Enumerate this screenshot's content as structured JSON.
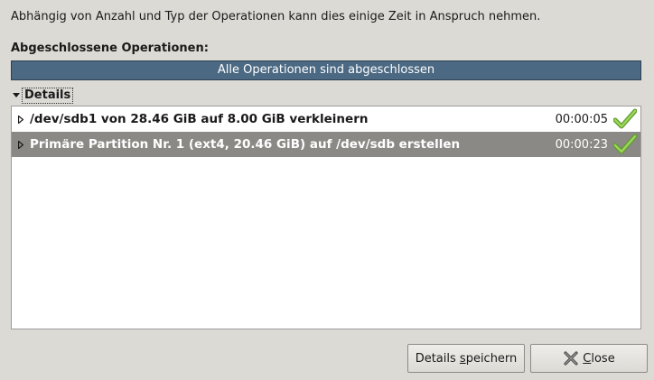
{
  "info_text": "Abhängig von Anzahl und Typ der Operationen kann dies einige Zeit in Anspruch nehmen.",
  "completed_label": "Abgeschlossene Operationen:",
  "progress": {
    "text": "Alle Operationen sind abgeschlossen",
    "fraction": 1.0
  },
  "details": {
    "label": "Details",
    "expanded": true
  },
  "operations": [
    {
      "text": "/dev/sdb1 von 28.46 GiB auf 8.00 GiB verkleinern",
      "time": "00:00:05",
      "status": "check-icon",
      "selected": false
    },
    {
      "text": "Primäre Partition Nr. 1 (ext4, 20.46 GiB) auf /dev/sdb erstellen",
      "time": "00:00:23",
      "status": "check-icon",
      "selected": true
    }
  ],
  "buttons": {
    "save_prefix": "Details ",
    "save_mnemonic": "s",
    "save_suffix": "peichern",
    "close_mnemonic": "C",
    "close_suffix": "lose"
  },
  "colors": {
    "progress": "#4b6983",
    "selected_row": "#8b8985",
    "check": "#7fc241"
  }
}
